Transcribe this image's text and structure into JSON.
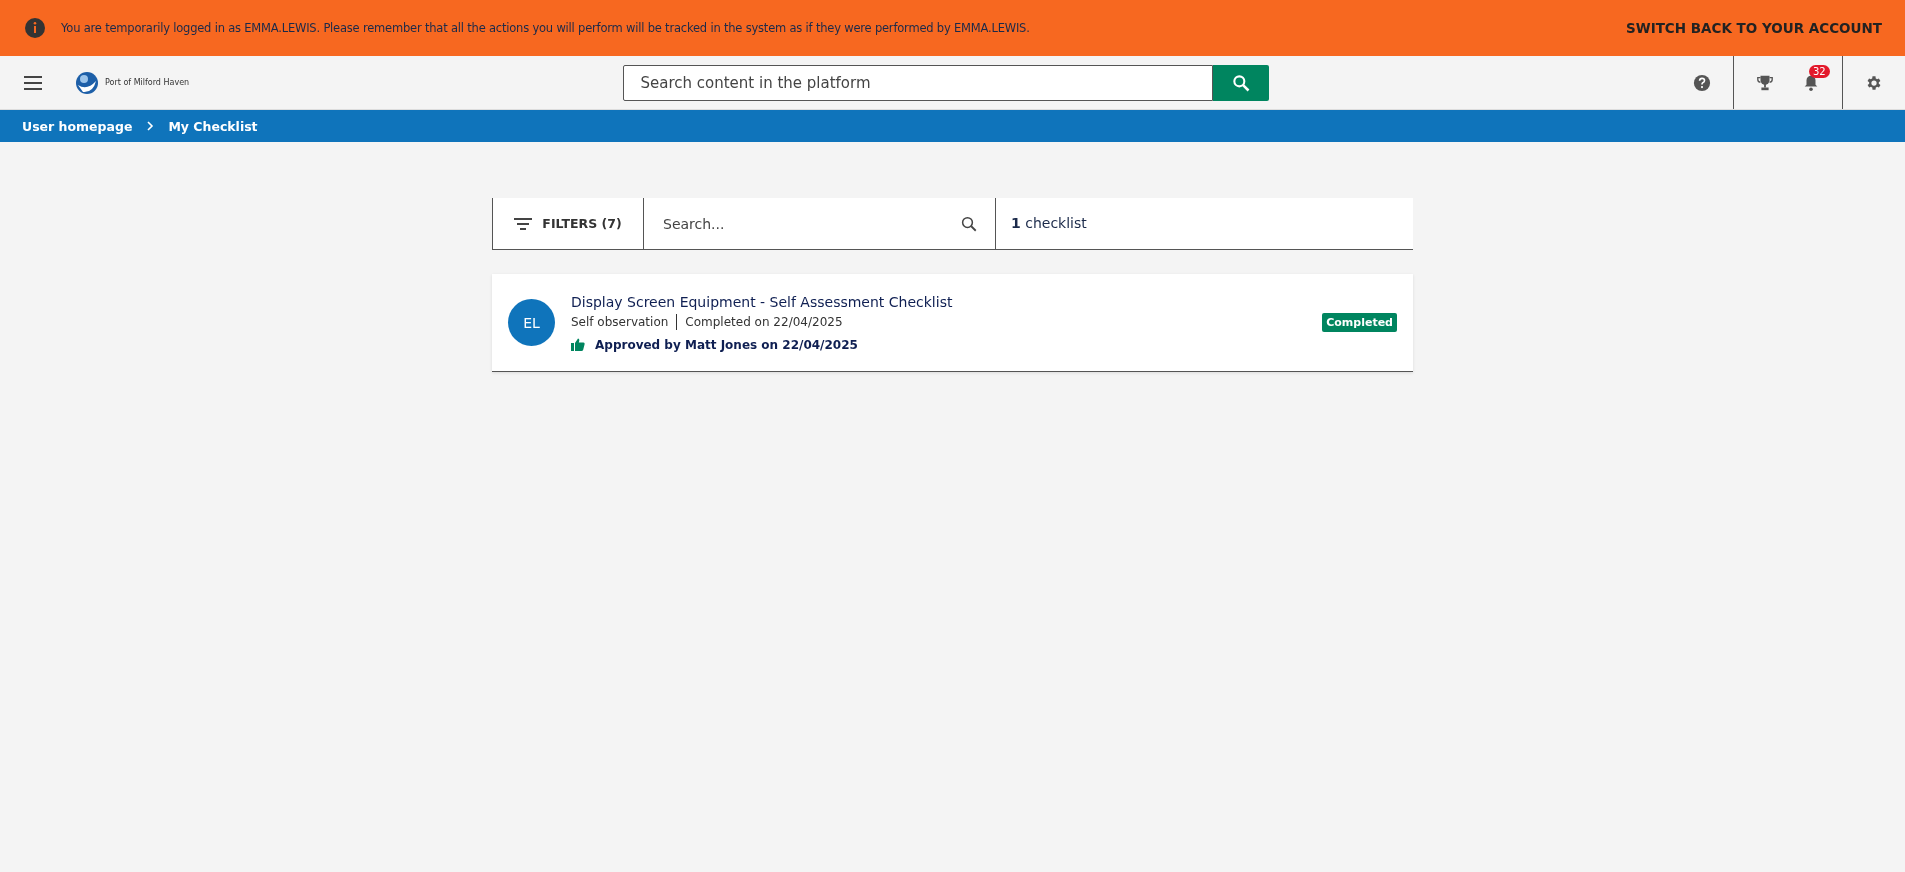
{
  "banner": {
    "message": "You are temporarily logged in as EMMA.LEWIS. Please remember that all the actions you will perform will be tracked in the system as if they were performed by EMMA.LEWIS.",
    "action": "SWITCH BACK TO YOUR ACCOUNT"
  },
  "header": {
    "logo_text": "Port of Milford Haven",
    "search": {
      "placeholder": "Search content in the platform"
    },
    "notification_count": "32"
  },
  "breadcrumb": [
    "User homepage",
    "My Checklist"
  ],
  "toolbar": {
    "filters": "FILTERS (7)",
    "search": {
      "placeholder": "Search..."
    },
    "count": "**1** checklist"
  },
  "checklists": [
    {
      "initials": "EL",
      "title": "Display Screen Equipment - Self Assessment Checklist",
      "type": "Self observation",
      "completed": "Completed on 22/04/2025",
      "approval": "Approved by Matt Jones on 22/04/2025",
      "status": "Completed"
    }
  ]
}
